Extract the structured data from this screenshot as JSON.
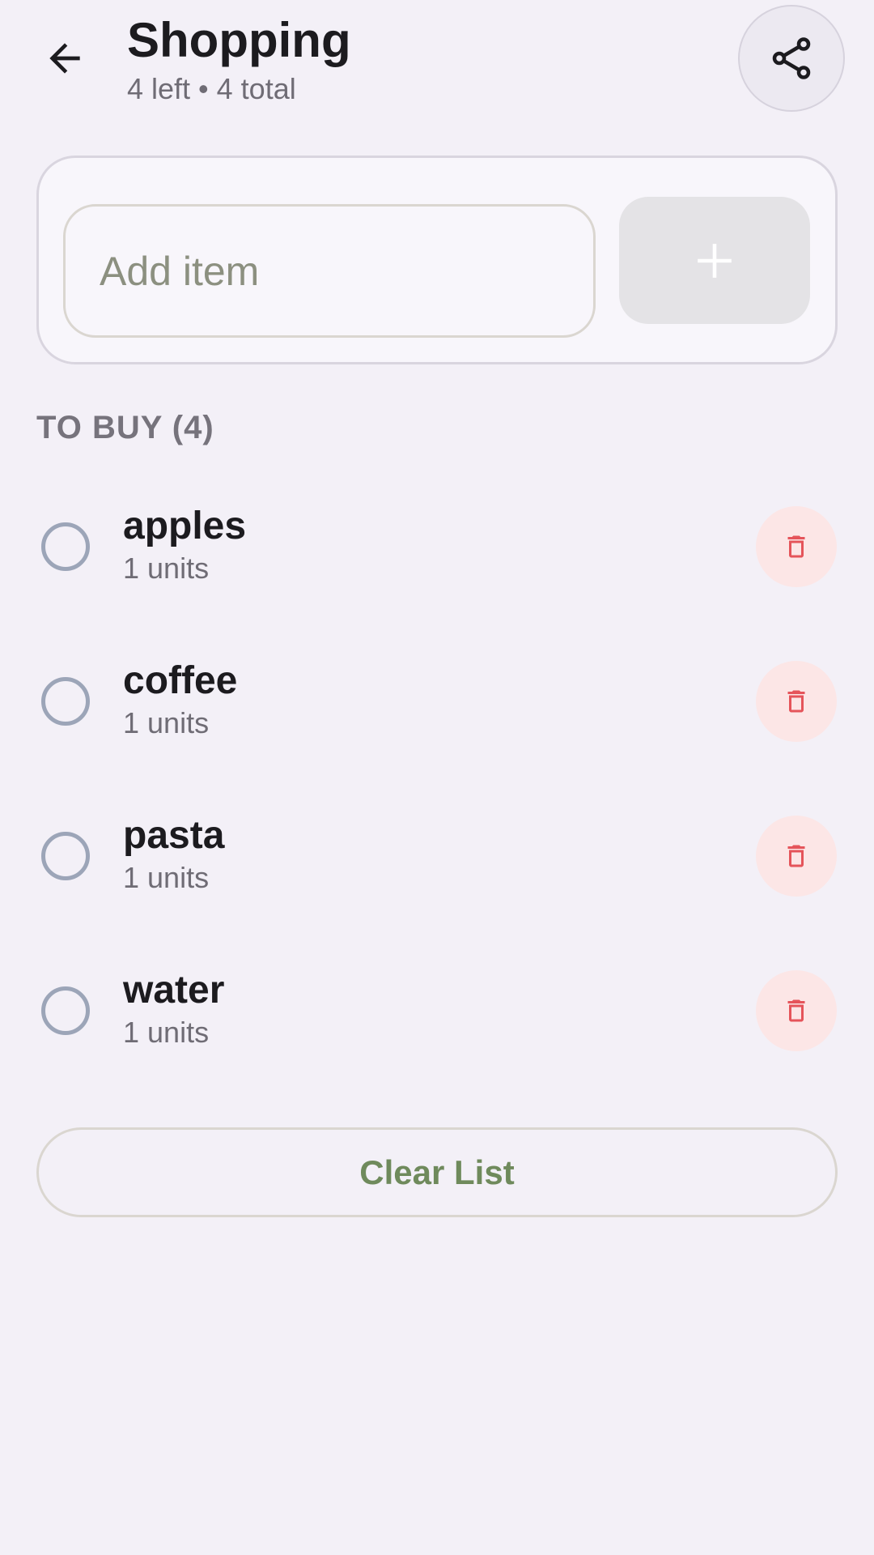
{
  "header": {
    "title": "Shopping",
    "subtitle": "4 left • 4 total",
    "back_icon": "arrow-left-icon",
    "share_icon": "share-icon"
  },
  "add_item": {
    "placeholder": "Add item",
    "value": "",
    "button_icon": "plus-icon"
  },
  "section": {
    "label": "TO BUY (4)"
  },
  "items": [
    {
      "name": "apples",
      "quantity": "1 units"
    },
    {
      "name": "coffee",
      "quantity": "1 units"
    },
    {
      "name": "pasta",
      "quantity": "1 units"
    },
    {
      "name": "water",
      "quantity": "1 units"
    }
  ],
  "footer": {
    "clear_label": "Clear List"
  },
  "colors": {
    "background": "#F3F0F7",
    "accent_green": "#6F8A5C",
    "delete_red": "#E5545A",
    "delete_bg": "#FCE6E6"
  }
}
